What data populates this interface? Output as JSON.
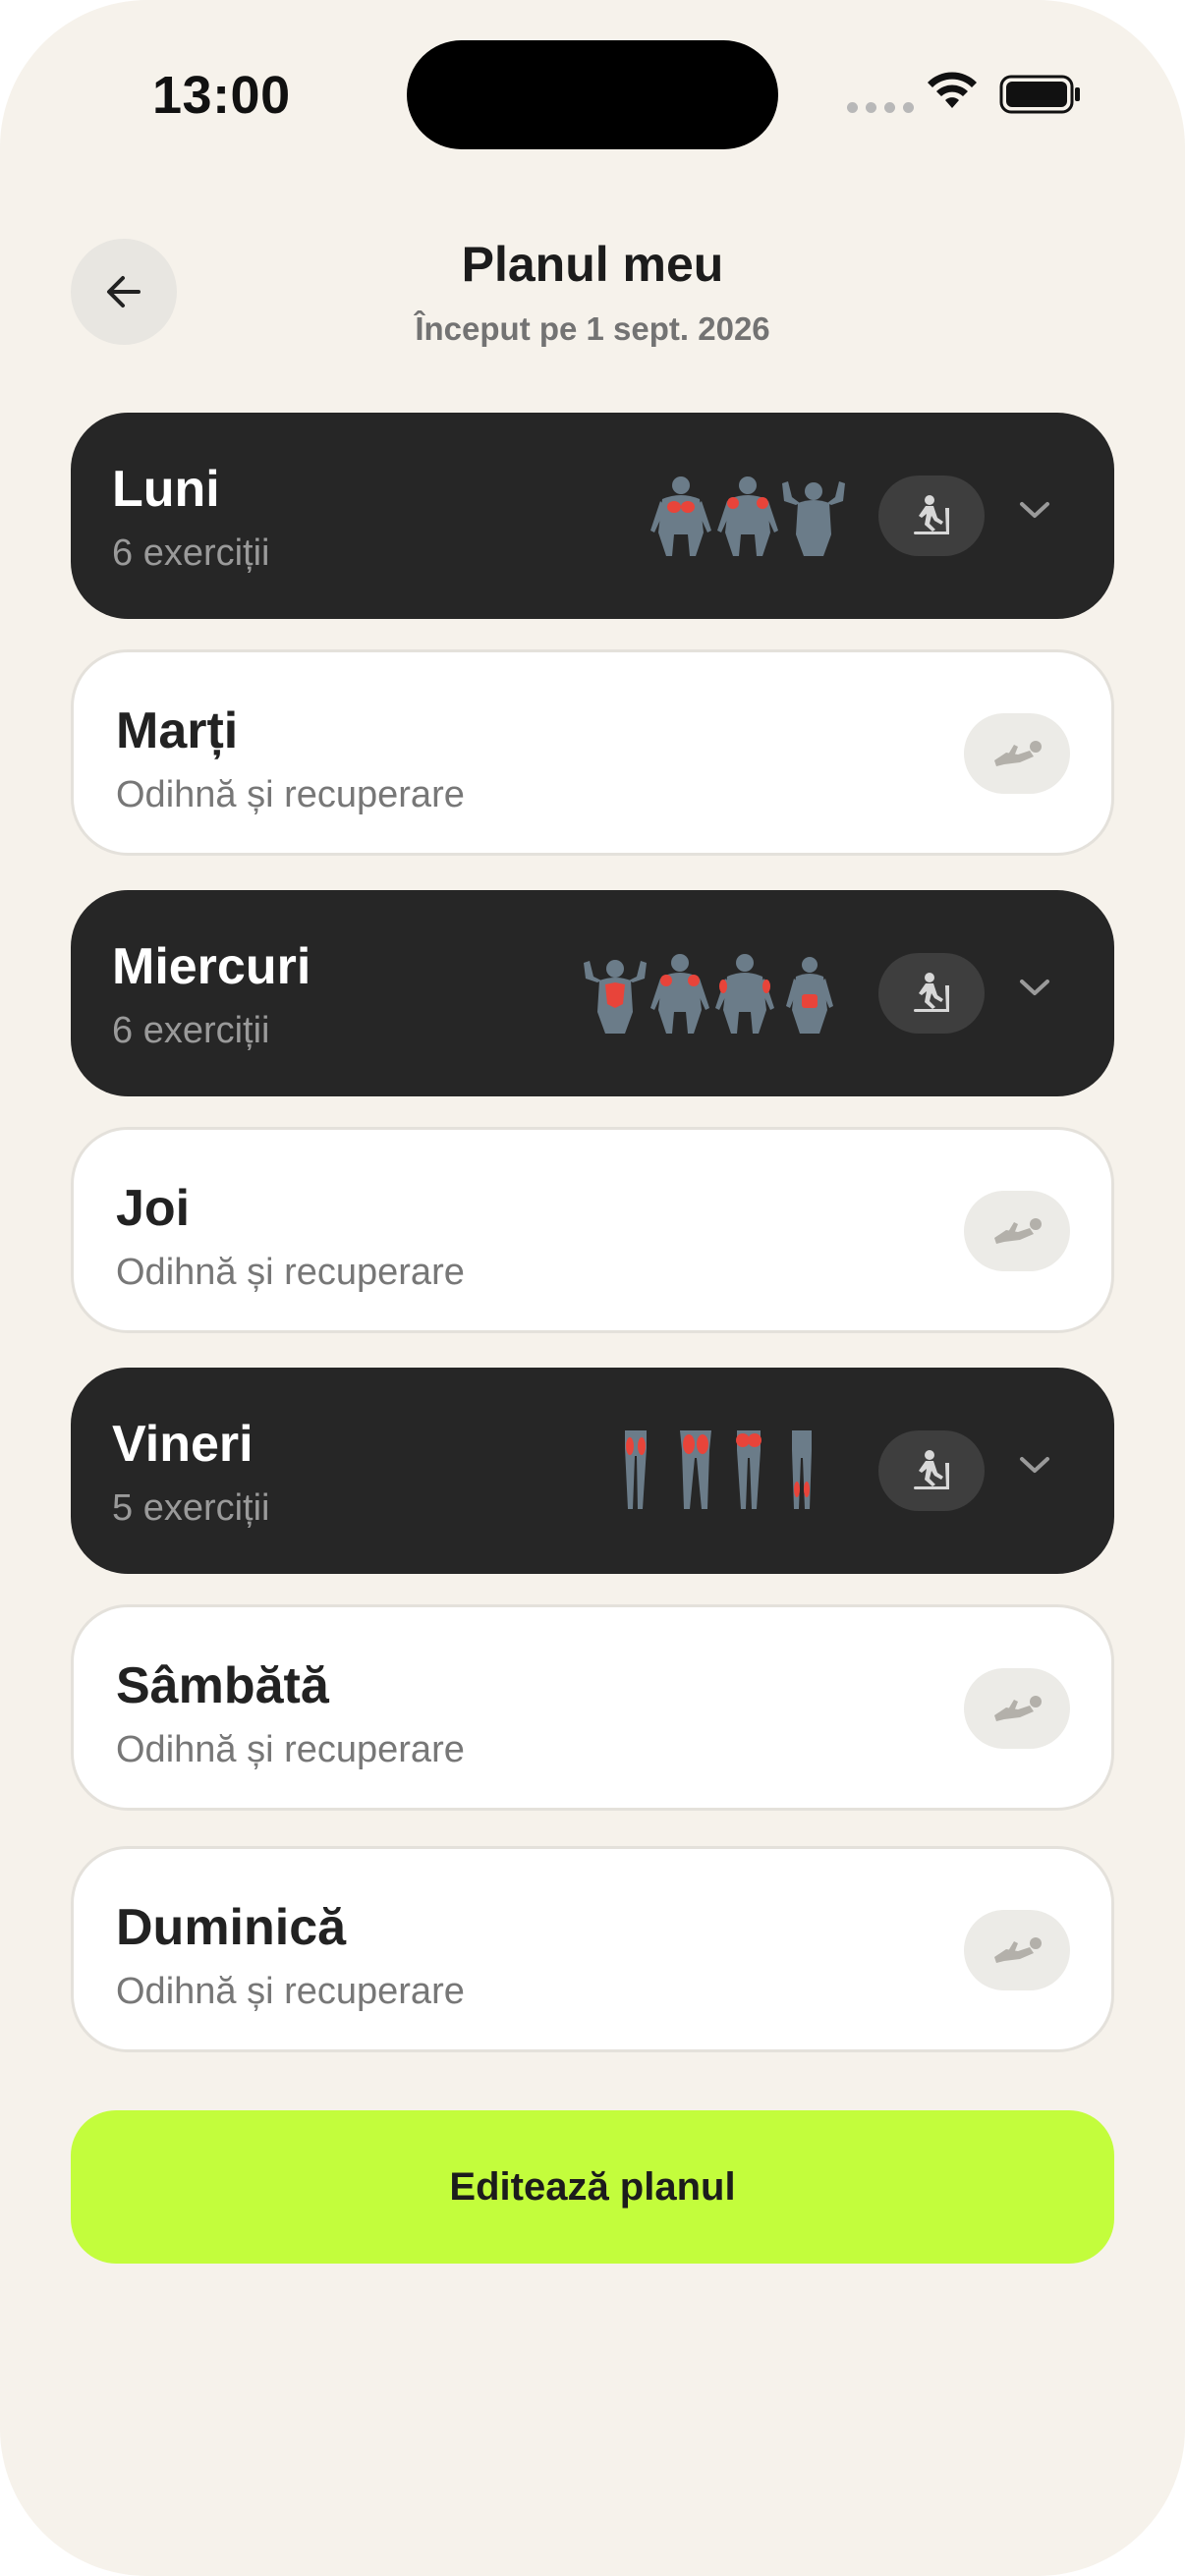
{
  "status": {
    "time": "13:00"
  },
  "header": {
    "title": "Planul meu",
    "subtitle": "Început pe 1 sept. 2026"
  },
  "days": [
    {
      "day": "Luni",
      "sub": "6 exerciții",
      "type": "workout",
      "muscles": [
        "chest",
        "shoulders",
        "biceps"
      ]
    },
    {
      "day": "Marți",
      "sub": "Odihnă și recuperare",
      "type": "rest"
    },
    {
      "day": "Miercuri",
      "sub": "6 exerciții",
      "type": "workout",
      "muscles": [
        "back",
        "shoulders",
        "triceps",
        "lower-back"
      ]
    },
    {
      "day": "Joi",
      "sub": "Odihnă și recuperare",
      "type": "rest"
    },
    {
      "day": "Vineri",
      "sub": "5 exerciții",
      "type": "workout",
      "muscles": [
        "hamstrings",
        "quads",
        "glutes",
        "calves"
      ]
    },
    {
      "day": "Sâmbătă",
      "sub": "Odihnă și recuperare",
      "type": "rest"
    },
    {
      "day": "Duminică",
      "sub": "Odihnă și recuperare",
      "type": "rest"
    }
  ],
  "cta": {
    "label": "Editează planul"
  },
  "colors": {
    "accent": "#c3fd3c",
    "dark_card": "#262626",
    "muscle_highlight": "#e8443a",
    "body": "#6b7c89"
  },
  "icons": {
    "back": "arrow-left-icon",
    "workout": "treadmill-icon",
    "rest": "lying-down-icon",
    "expand": "chevron-down-icon"
  }
}
